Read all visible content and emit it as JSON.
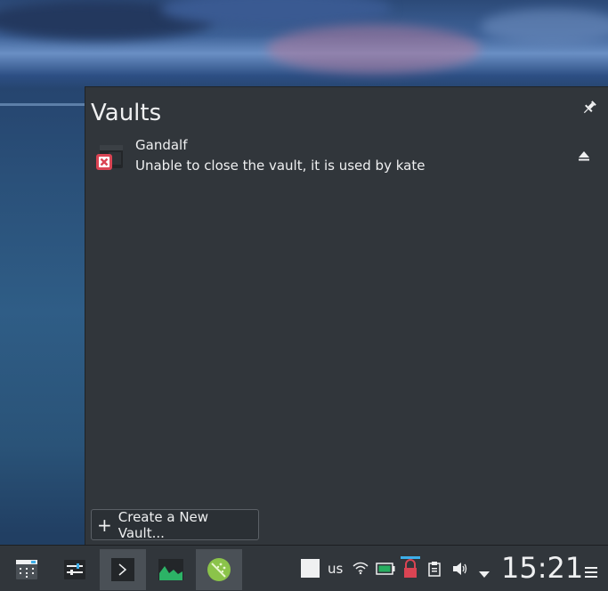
{
  "popup": {
    "title": "Vaults",
    "pin_icon": "pin-icon",
    "vault": {
      "name": "Gandalf",
      "status": "Unable to close the vault, it is used by kate",
      "icon": "vault-error-icon",
      "eject_icon": "eject-icon"
    },
    "create_button": {
      "icon": "plus-icon",
      "label": "Create a New Vault..."
    }
  },
  "taskbar": {
    "launchers": [
      {
        "name": "application-launcher",
        "icon": "app-menu-icon"
      },
      {
        "name": "system-settings",
        "icon": "settings-icon"
      },
      {
        "name": "terminal",
        "icon": "terminal-icon"
      },
      {
        "name": "system-monitor",
        "icon": "system-monitor-icon"
      },
      {
        "name": "kdeconnect-app",
        "icon": "green-app-icon"
      }
    ],
    "tray": {
      "keyboard_layout": "us",
      "clock": "15:21"
    }
  },
  "colors": {
    "panel_bg": "#31363b",
    "text": "#eff0f1",
    "error_red": "#da4453",
    "accent_blue": "#3daee9"
  }
}
